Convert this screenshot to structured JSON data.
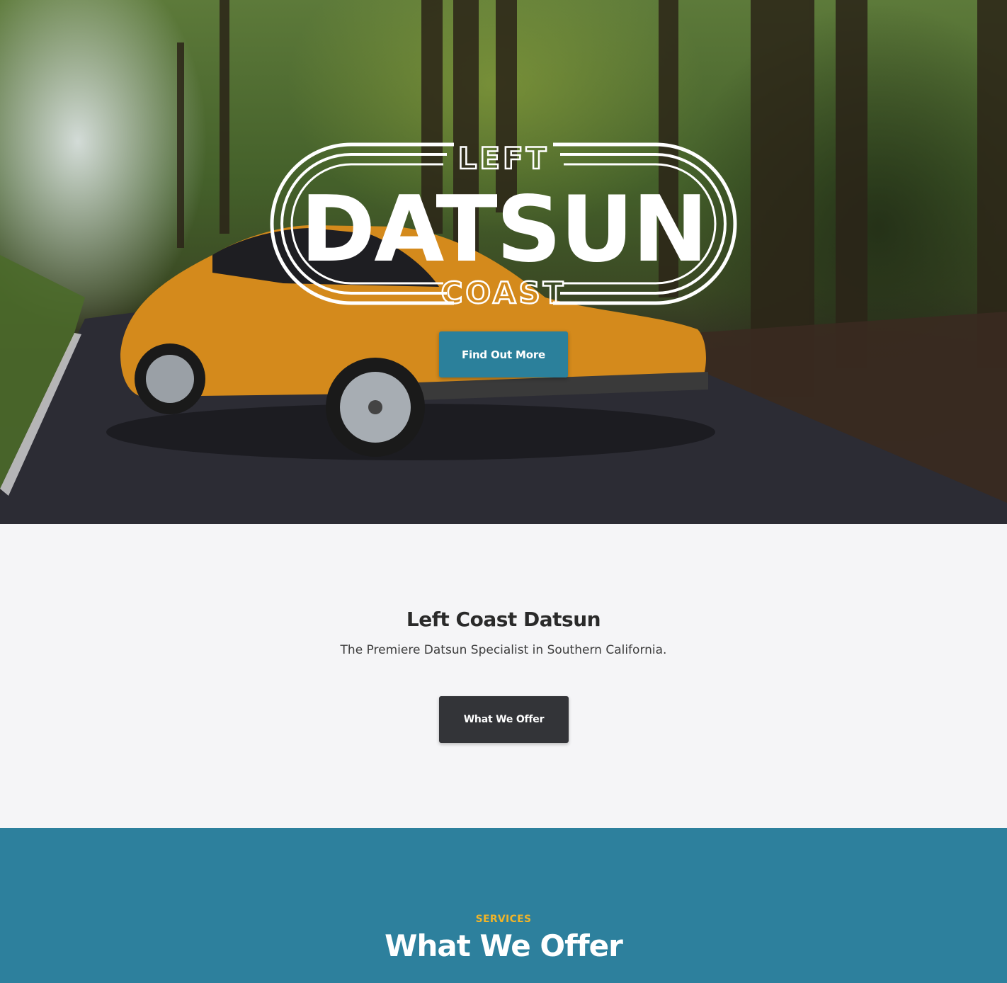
{
  "hero": {
    "logo": {
      "top_word": "LEFT",
      "main_word": "DATSUN",
      "bottom_word": "COAST"
    },
    "cta_label": "Find Out More"
  },
  "about": {
    "title": "Left Coast Datsun",
    "subtitle": "The Premiere Datsun Specialist in Southern California.",
    "cta_label": "What We Offer"
  },
  "services": {
    "eyebrow": "SERVICES",
    "title": "What We Offer"
  },
  "colors": {
    "primary_teal": "#2b809b",
    "dark_button": "#333438",
    "accent_gold": "#f0b429",
    "light_bg": "#f5f5f7"
  }
}
